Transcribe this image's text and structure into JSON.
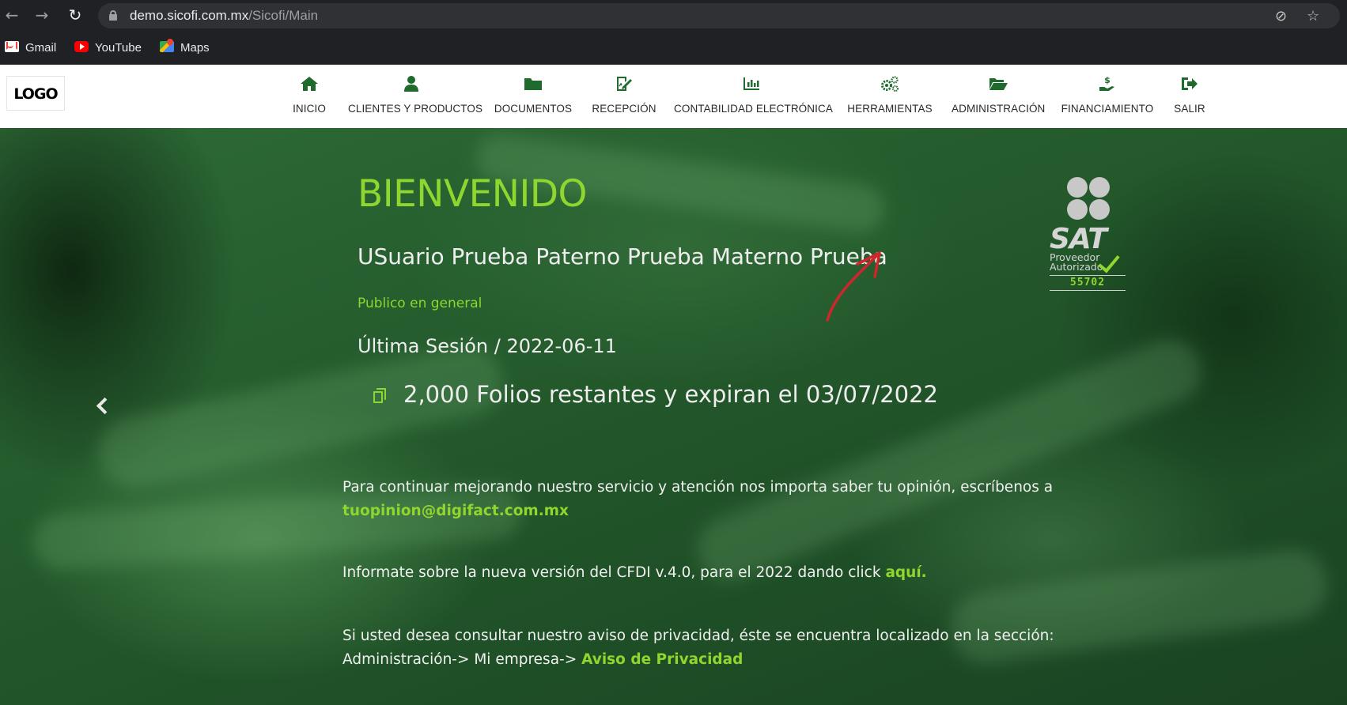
{
  "browser": {
    "url_host": "demo.sicofi.com.mx",
    "url_path": "/Sicofi/Main",
    "bookmarks": [
      {
        "label": "Gmail",
        "icon": "gmail-icon"
      },
      {
        "label": "YouTube",
        "icon": "youtube-icon"
      },
      {
        "label": "Maps",
        "icon": "maps-icon"
      }
    ]
  },
  "site": {
    "logo": "LOGO",
    "nav": [
      {
        "label": "INICIO",
        "icon": "home-icon"
      },
      {
        "label": "CLIENTES Y PRODUCTOS",
        "icon": "user-icon"
      },
      {
        "label": "DOCUMENTOS",
        "icon": "folder-icon"
      },
      {
        "label": "RECEPCIÓN",
        "icon": "signature-icon"
      },
      {
        "label": "CONTABILIDAD ELECTRÓNICA",
        "icon": "bar-chart-icon"
      },
      {
        "label": "HERRAMIENTAS",
        "icon": "gears-icon"
      },
      {
        "label": "ADMINISTRACIÓN",
        "icon": "folder-open-icon"
      },
      {
        "label": "FINANCIAMIENTO",
        "icon": "hand-dollar-icon"
      },
      {
        "label": "SALIR",
        "icon": "sign-out-icon"
      }
    ],
    "accent_color": "#8fd62f",
    "nav_icon_color": "#1f6b2e"
  },
  "welcome": {
    "title": "BIENVENIDO",
    "user_name": "USuario Prueba Paterno Prueba Materno Prueba",
    "role": "Publico en general",
    "last_session": "Última Sesión / 2022-06-11",
    "folios": "2,000 Folios restantes y expiran el 03/07/2022"
  },
  "messages": {
    "opinion_text": "Para continuar mejorando nuestro servicio y atención nos importa saber tu opinión, escríbenos a",
    "opinion_email": "tuopinion@digifact.com.mx",
    "cfdi_text": "Informate sobre la nueva versión del CFDI v.4.0, para el 2022 dando click",
    "cfdi_link": "aquí.",
    "privacy_text": "Si usted desea consultar nuestro aviso de privacidad, éste se encuentra localizado en la sección: Administración-> Mi empresa->",
    "privacy_link": "Aviso de Privacidad"
  },
  "sat_badge": {
    "word": "SAT",
    "line1": "Proveedor",
    "line2": "Autorizado",
    "number": "55702"
  }
}
